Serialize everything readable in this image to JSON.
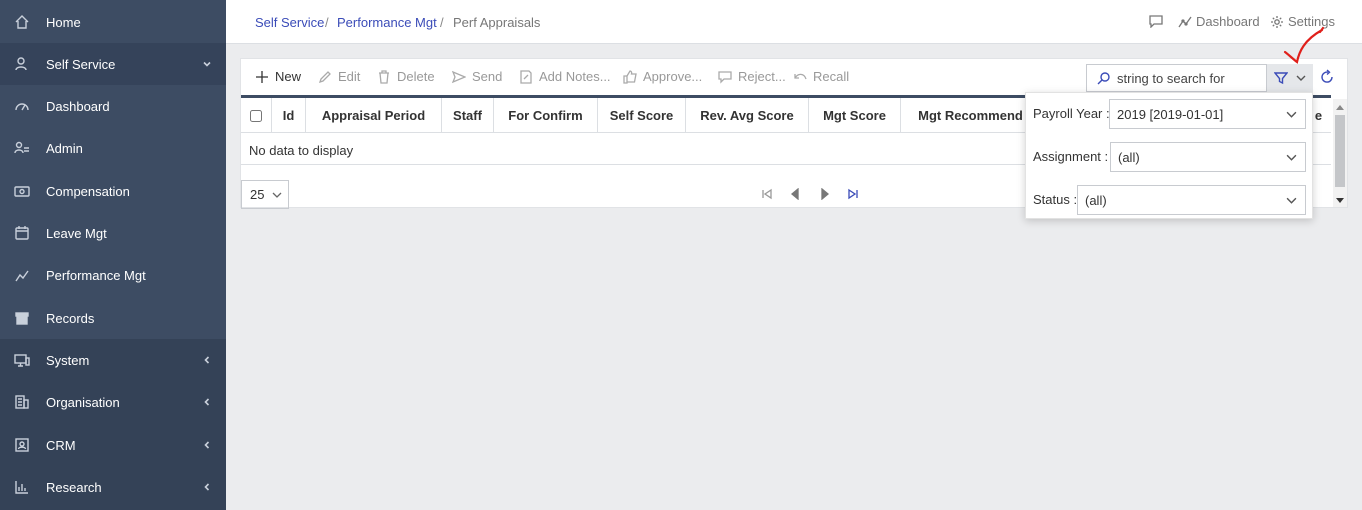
{
  "sidebar": {
    "items": [
      {
        "label": "Home",
        "icon": "home-icon"
      },
      {
        "label": "Self Service",
        "icon": "user-icon",
        "chevron": "down"
      },
      {
        "label": "Dashboard",
        "icon": "dashboard-icon"
      },
      {
        "label": "Admin",
        "icon": "admin-icon"
      },
      {
        "label": "Compensation",
        "icon": "money-icon"
      },
      {
        "label": "Leave Mgt",
        "icon": "calendar-icon"
      },
      {
        "label": "Performance Mgt",
        "icon": "performance-icon"
      },
      {
        "label": "Records",
        "icon": "archive-icon"
      },
      {
        "label": "System",
        "icon": "monitor-icon",
        "chevron": "left"
      },
      {
        "label": "Organisation",
        "icon": "building-icon",
        "chevron": "left"
      },
      {
        "label": "CRM",
        "icon": "crm-icon",
        "chevron": "left"
      },
      {
        "label": "Research",
        "icon": "chart-icon",
        "chevron": "left"
      }
    ]
  },
  "breadcrumb": {
    "items": [
      "Self Service",
      "Performance Mgt",
      "Perf Appraisals"
    ],
    "separator": "/"
  },
  "top_actions": {
    "dashboard": "Dashboard",
    "settings": "Settings"
  },
  "toolbar": {
    "new": "New",
    "edit": "Edit",
    "delete": "Delete",
    "send": "Send",
    "add_notes": "Add Notes...",
    "approve": "Approve...",
    "reject": "Reject...",
    "recall": "Recall"
  },
  "search": {
    "value": "string to search for"
  },
  "grid": {
    "columns": [
      "Id",
      "Appraisal Period",
      "Staff",
      "For Confirm",
      "Self Score",
      "Rev. Avg Score",
      "Mgt Score",
      "Mgt Recommend",
      "e"
    ],
    "empty_text": "No data to display"
  },
  "pager": {
    "page_size": "25"
  },
  "filter_popup": {
    "payroll_year_label": "Payroll Year :",
    "payroll_year_value": "2019 [2019-01-01]",
    "assignment_label": "Assignment :",
    "assignment_value": "(all)",
    "status_label": "Status :",
    "status_value": "(all)"
  },
  "colors": {
    "sidebar_bg": "#3d4c63",
    "accent": "#3b4cb8",
    "annotation": "#e0201b"
  }
}
